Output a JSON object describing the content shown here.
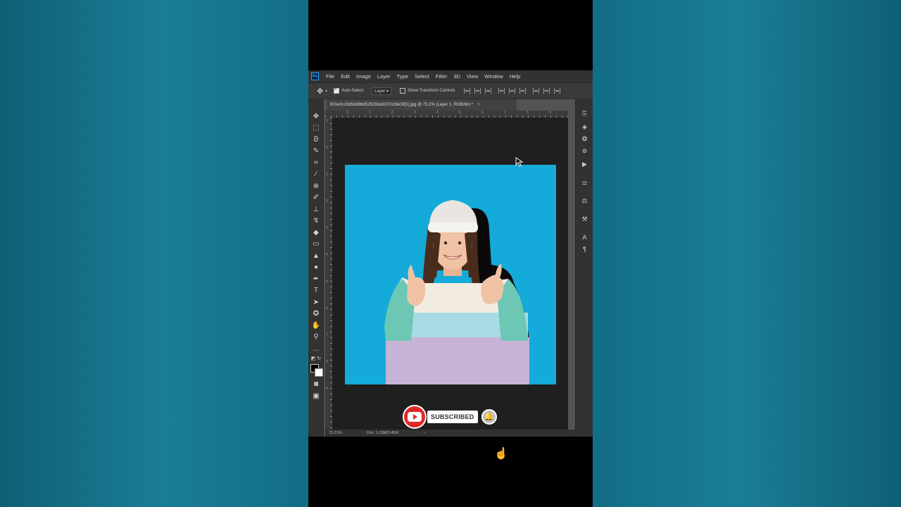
{
  "menubar": {
    "app_logo": "Ps",
    "items": [
      "File",
      "Edit",
      "Image",
      "Layer",
      "Type",
      "Select",
      "Filter",
      "3D",
      "View",
      "Window",
      "Help"
    ]
  },
  "options": {
    "auto_select_label": "Auto-Select",
    "auto_select_checked": true,
    "layer_value": "Layer",
    "show_transform_label": "Show Transform Controls",
    "show_transform_checked": false
  },
  "document": {
    "tab_title": "601e0c19d5dd98d52629da5370116e39[1].jpg @ 73.2% (Layer 1, RGB/8#) *",
    "close_glyph": "×"
  },
  "ruler": {
    "h_labels": [
      "0",
      "1",
      "2",
      "3",
      "4",
      "5",
      "6",
      "7",
      "8",
      "9"
    ],
    "v_labels": [
      "2",
      "0",
      "1",
      "2",
      "3",
      "4",
      "5",
      "6",
      "7",
      "8",
      "9"
    ]
  },
  "status": {
    "zoom": "73.21%",
    "doc": "Doc: 1.23M/3.45M",
    "arrow": "›"
  },
  "overlay": {
    "subscribe_label": "SUBSCRIBED"
  },
  "tools": [
    "move-icon",
    "marquee-icon",
    "lasso-icon",
    "quick-select-icon",
    "crop-icon",
    "eyedropper-icon",
    "healing-icon",
    "brush-icon",
    "stamp-icon",
    "history-brush-icon",
    "eraser-icon",
    "gradient-icon",
    "blur-icon",
    "dodge-icon",
    "pen-icon",
    "type-icon",
    "path-select-icon",
    "shape-icon",
    "hand-icon",
    "zoom-icon",
    "more-icon"
  ],
  "panels": [
    "history-icon",
    "layers-icon",
    "channels-icon",
    "paths-icon",
    "actions-icon",
    "properties-icon",
    "adjustments-icon",
    "brush-settings-icon",
    "character-icon",
    "paragraph-icon"
  ],
  "colors": {
    "canvas_bg": "#14aad9",
    "sweater_mint": "#6cc7b4",
    "sweater_lilac": "#c6b3d6",
    "sweater_sky": "#a8dbe6",
    "sweater_cream": "#f2ece0",
    "youtube_red": "#e02828"
  }
}
